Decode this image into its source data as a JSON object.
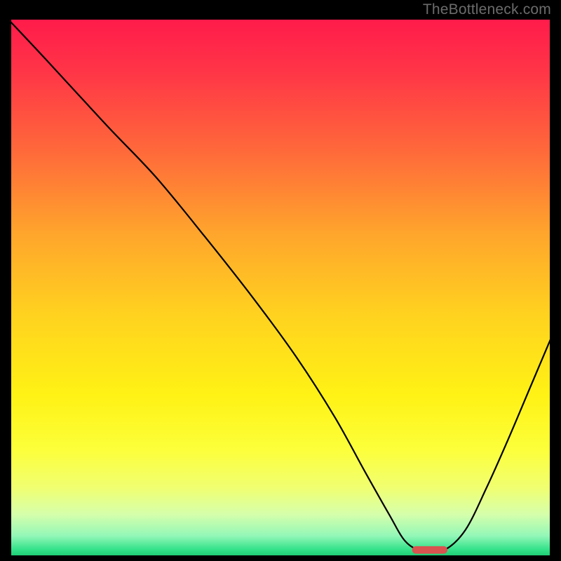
{
  "watermark": "TheBottleneck.com",
  "chart_data": {
    "type": "line",
    "title": "",
    "xlabel": "",
    "ylabel": "",
    "xlim": [
      0,
      100
    ],
    "ylim": [
      0,
      100
    ],
    "grid": false,
    "legend": false,
    "gradient_stops": [
      {
        "offset": 0.0,
        "color": "#ff1a4b"
      },
      {
        "offset": 0.1,
        "color": "#ff3547"
      },
      {
        "offset": 0.25,
        "color": "#ff6a3a"
      },
      {
        "offset": 0.4,
        "color": "#ffa52c"
      },
      {
        "offset": 0.55,
        "color": "#ffd21f"
      },
      {
        "offset": 0.7,
        "color": "#fff215"
      },
      {
        "offset": 0.8,
        "color": "#fcff3a"
      },
      {
        "offset": 0.87,
        "color": "#f1ff70"
      },
      {
        "offset": 0.92,
        "color": "#d6ffab"
      },
      {
        "offset": 0.96,
        "color": "#93f7b8"
      },
      {
        "offset": 0.985,
        "color": "#34e28a"
      },
      {
        "offset": 1.0,
        "color": "#17c96e"
      }
    ],
    "series": [
      {
        "name": "bottleneck-curve",
        "x": [
          0.0,
          7.0,
          18.0,
          27.0,
          36.0,
          45.0,
          53.0,
          60.0,
          65.5,
          70.0,
          73.0,
          76.0,
          80.0,
          84.0,
          88.0,
          92.0,
          96.0,
          100.0
        ],
        "y": [
          99.5,
          92.0,
          80.0,
          70.5,
          59.5,
          48.0,
          37.0,
          26.0,
          16.0,
          8.0,
          3.0,
          1.3,
          1.3,
          5.0,
          13.0,
          22.0,
          31.5,
          41.0
        ]
      }
    ],
    "marker": {
      "x_center": 77.5,
      "y_center": 1.4,
      "width": 6.5,
      "height": 1.4,
      "rx": 0.7,
      "color": "#d9534f"
    },
    "axes_color": "#000000",
    "curve_color": "#000000",
    "curve_width": 2.2
  }
}
